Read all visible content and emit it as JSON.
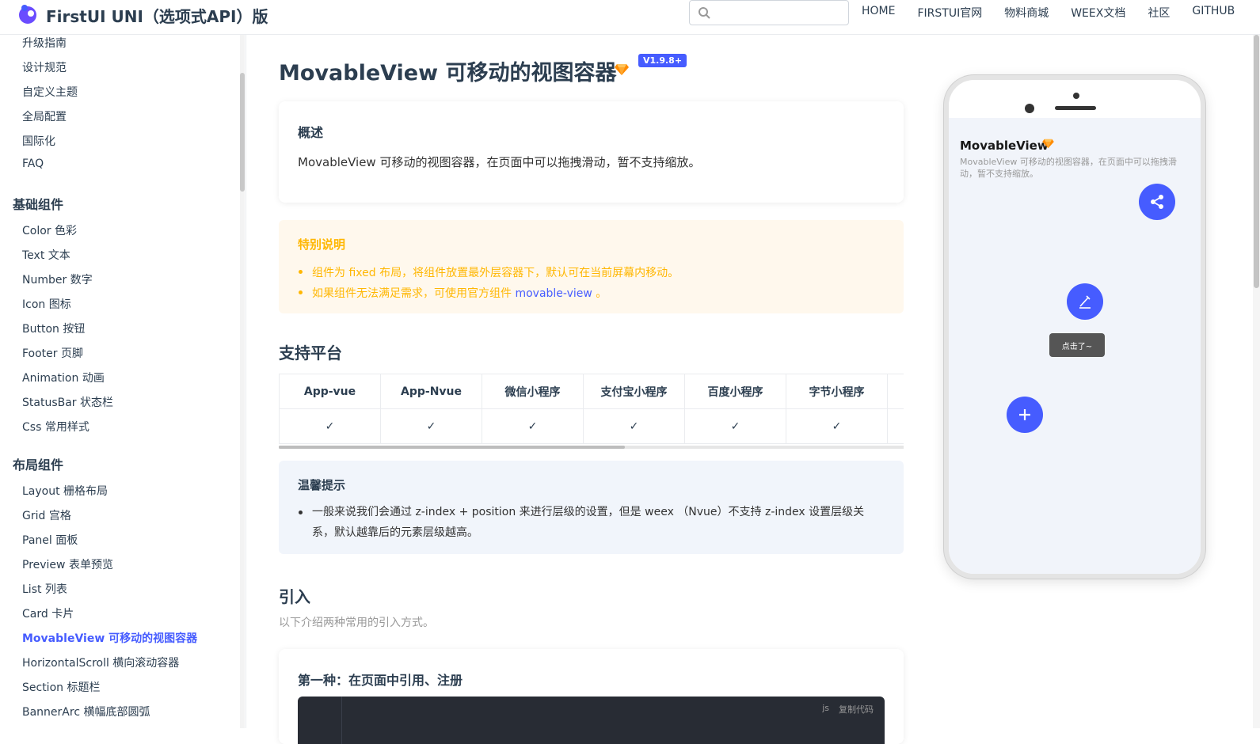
{
  "header": {
    "site_title": "FirstUI UNI（选项式API）版",
    "search": {
      "value": "",
      "placeholder": ""
    },
    "nav": [
      "HOME",
      "FIRSTUI官网",
      "物料商城",
      "WEEX文档",
      "社区",
      "GITHUB"
    ]
  },
  "sidebar": {
    "links_top": [
      "升级指南",
      "设计规范",
      "自定义主题",
      "全局配置",
      "国际化",
      "FAQ"
    ],
    "group_basic": "基础组件",
    "links_basic": [
      "Color 色彩",
      "Text 文本",
      "Number 数字",
      "Icon 图标",
      "Button 按钮",
      "Footer 页脚",
      "Animation 动画",
      "StatusBar 状态栏",
      "Css 常用样式"
    ],
    "group_layout": "布局组件",
    "links_layout": [
      "Layout 栅格布局",
      "Grid 宫格",
      "Panel 面板",
      "Preview 表单预览",
      "List 列表",
      "Card 卡片",
      "MovableView 可移动的视图容器",
      "HorizontalScroll 横向滚动容器",
      "Section 标题栏",
      "BannerArc 横幅底部圆弧"
    ],
    "active_link": "MovableView 可移动的视图容器"
  },
  "main": {
    "title": "MovableView 可移动的视图容器",
    "version": "V1.9.8+",
    "overview": {
      "title": "概述",
      "text": "MovableView 可移动的视图容器，在页面中可以拖拽滑动，暂不支持缩放。"
    },
    "notice": {
      "title": "特别说明",
      "item1": "组件为 fixed 布局，将组件放置最外层容器下，默认可在当前屏幕内移动。",
      "item2_prefix": "如果组件无法满足需求，可使用官方组件 ",
      "item2_link": "movable-view",
      "item2_suffix": " 。"
    },
    "platforms": {
      "heading": "支持平台",
      "headers": [
        "App-vue",
        "App-Nvue",
        "微信小程序",
        "支付宝小程序",
        "百度小程序",
        "字节小程序"
      ],
      "values": [
        "✓",
        "✓",
        "✓",
        "✓",
        "✓",
        "✓"
      ]
    },
    "tip": {
      "title": "温馨提示",
      "item": "一般来说我们会通过 z-index + position 来进行层级的设置，但是 weex （Nvue）不支持 z-index 设置层级关系，默认越靠后的元素层级越高。"
    },
    "import": {
      "heading": "引入",
      "desc": "以下介绍两种常用的引入方式。",
      "card_title": "第一种：在页面中引用、注册",
      "code_lang": "js",
      "copy_label": "复制代码"
    }
  },
  "phone": {
    "title": "MovableView",
    "desc": "MovableView 可移动的视图容器，在页面中可以拖拽滑动，暂不支持缩放。",
    "toast": "点击了~"
  },
  "colors": {
    "accent": "#465CFF",
    "warning": "#FFB703",
    "notice_bg": "#FFF8ED",
    "tip_bg": "#F1F5FB"
  }
}
